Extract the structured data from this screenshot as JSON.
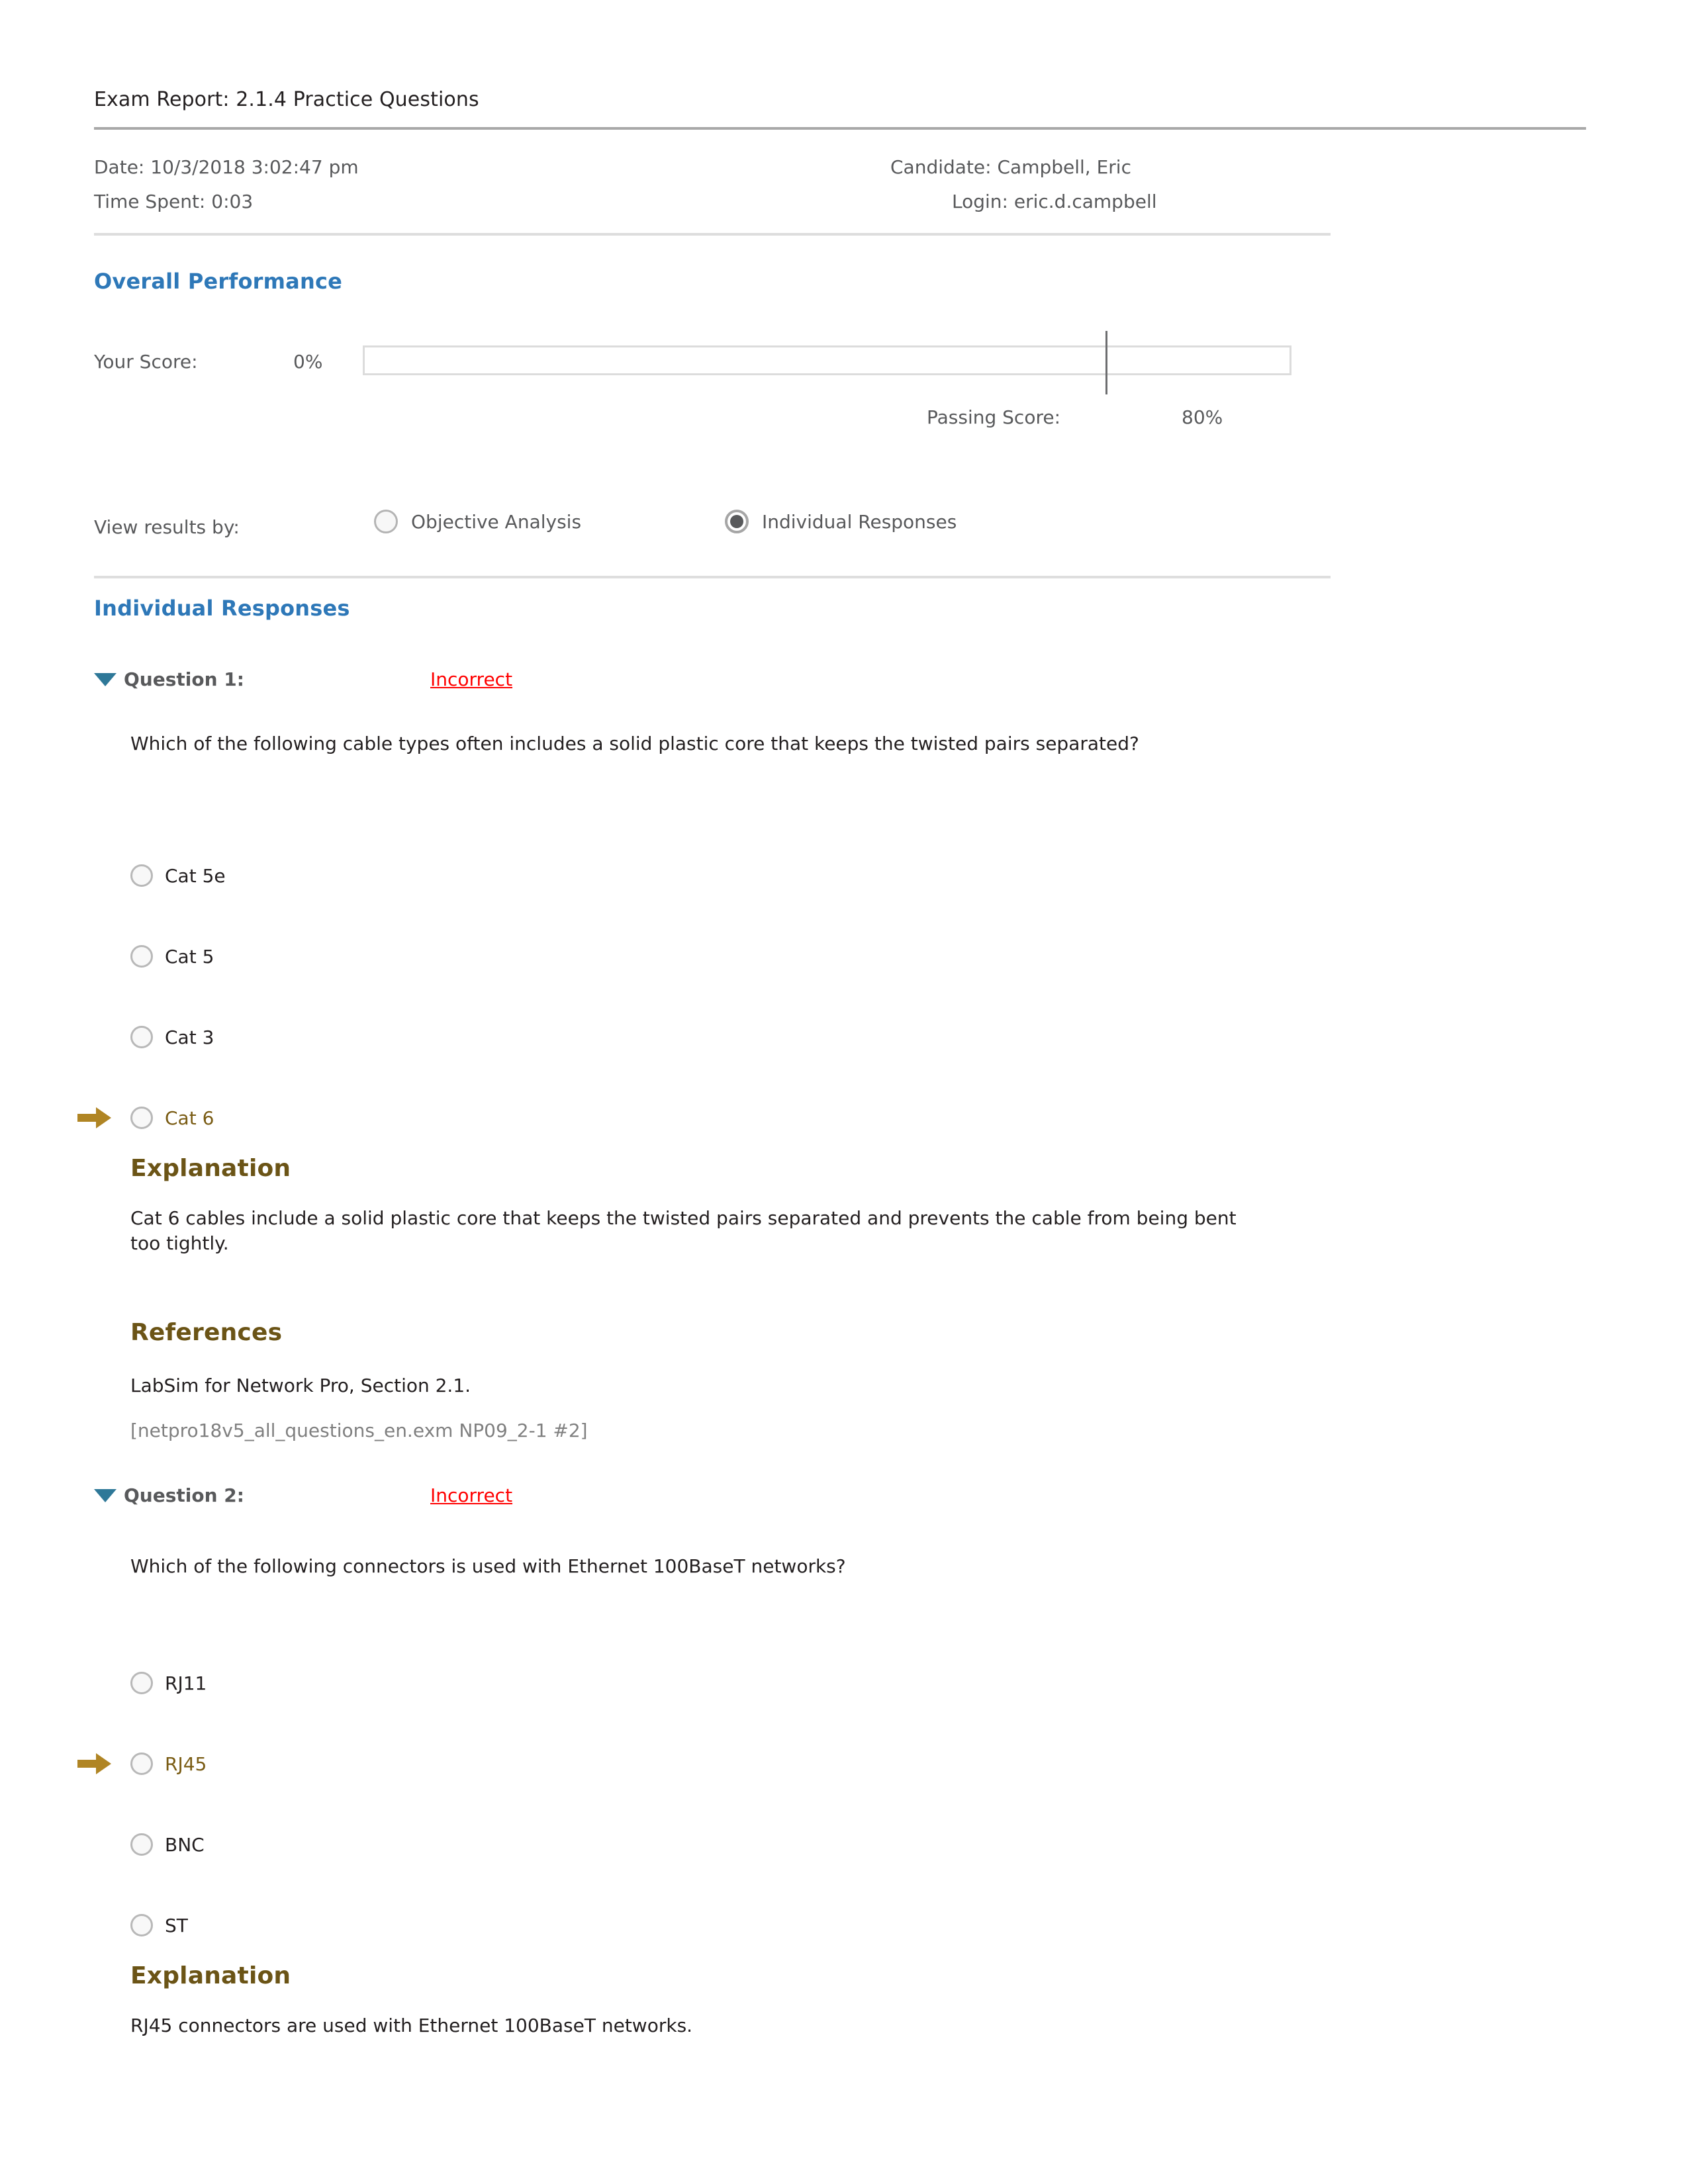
{
  "header": {
    "title": "Exam Report: 2.1.4 Practice Questions",
    "date_label": "Date: 10/3/2018 3:02:47 pm",
    "time_spent_label": "Time Spent: 0:03",
    "candidate_label": "Candidate: Campbell, Eric",
    "login_label": "Login: eric.d.campbell"
  },
  "overall": {
    "heading": "Overall Performance",
    "your_score_label": "Your Score:",
    "your_score_value": "0%",
    "your_score_percent": 0,
    "passing_score_label": "Passing Score:",
    "passing_score_value": "80%",
    "passing_score_percent": 80
  },
  "view_results": {
    "label": "View results by:",
    "options": [
      {
        "label": "Objective Analysis",
        "selected": false
      },
      {
        "label": "Individual Responses",
        "selected": true
      }
    ]
  },
  "individual_responses": {
    "heading": "Individual Responses",
    "questions": [
      {
        "label": "Question 1:",
        "status": "Incorrect",
        "status_color": "#ff0000",
        "toggle_icon": "triangle-down-icon",
        "prompt": "Which of the following cable types often includes a solid plastic core that keeps the twisted pairs separated?",
        "options": [
          {
            "text": "Cat 5e",
            "selected": false,
            "answer_marker": false
          },
          {
            "text": "Cat 5",
            "selected": false,
            "answer_marker": false
          },
          {
            "text": "Cat 3",
            "selected": false,
            "answer_marker": false
          },
          {
            "text": "Cat 6",
            "selected": false,
            "answer_marker": true
          }
        ],
        "explanation_heading": "Explanation",
        "explanation_text": "Cat 6 cables include a solid plastic core that keeps the twisted pairs separated and prevents the cable from being bent too tightly.",
        "references_heading": "References",
        "references_text": "LabSim for Network Pro, Section 2.1.",
        "references_code": "[netpro18v5_all_questions_en.exm NP09_2-1 #2]"
      },
      {
        "label": "Question 2:",
        "status": "Incorrect",
        "status_color": "#ff0000",
        "toggle_icon": "triangle-down-icon",
        "prompt": "Which of the following connectors is used with Ethernet 100BaseT networks?",
        "options": [
          {
            "text": "RJ11",
            "selected": false,
            "answer_marker": false
          },
          {
            "text": "RJ45",
            "selected": false,
            "answer_marker": true
          },
          {
            "text": "BNC",
            "selected": false,
            "answer_marker": false
          },
          {
            "text": "ST",
            "selected": false,
            "answer_marker": false
          }
        ],
        "explanation_heading": "Explanation",
        "explanation_text": "RJ45 connectors are used with Ethernet 100BaseT networks.",
        "references_heading": "",
        "references_text": "",
        "references_code": ""
      }
    ]
  },
  "colors": {
    "heading_blue": "#2e78b8",
    "heading_brown": "#6b5416",
    "answer_brown": "#7a5c14",
    "status_red": "#ff0000",
    "meta_gray": "#58595b",
    "triangle_teal": "#2e7898"
  }
}
